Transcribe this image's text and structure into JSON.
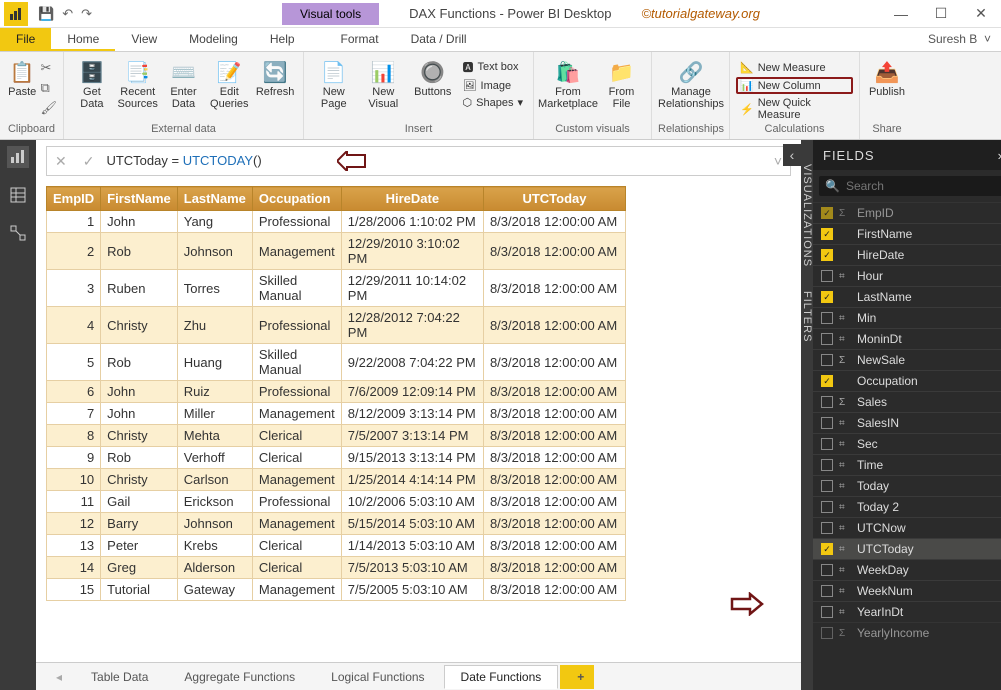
{
  "titlebar": {
    "app_title": "DAX Functions - Power BI Desktop",
    "visual_tools": "Visual tools",
    "watermark": "©tutorialgateway.org"
  },
  "menu": {
    "file": "File",
    "tabs": [
      "Home",
      "View",
      "Modeling",
      "Help",
      "Format",
      "Data / Drill"
    ],
    "user": "Suresh B"
  },
  "ribbon": {
    "clipboard": {
      "paste": "Paste",
      "label": "Clipboard"
    },
    "external": {
      "get": "Get\nData",
      "recent": "Recent\nSources",
      "enter": "Enter\nData",
      "edit": "Edit\nQueries",
      "refresh": "Refresh",
      "label": "External data"
    },
    "insert": {
      "newpage": "New\nPage",
      "newvisual": "New\nVisual",
      "buttons": "Buttons",
      "text": "Text box",
      "image": "Image",
      "shapes": "Shapes",
      "label": "Insert"
    },
    "custom": {
      "market": "From\nMarketplace",
      "file": "From\nFile",
      "label": "Custom visuals"
    },
    "rel": {
      "manage": "Manage\nRelationships",
      "label": "Relationships"
    },
    "calc": {
      "measure": "New Measure",
      "column": "New Column",
      "quick": "New Quick Measure",
      "label": "Calculations"
    },
    "share": {
      "publish": "Publish",
      "label": "Share"
    }
  },
  "formula": {
    "text": "UTCToday = ",
    "func": "UTCTODAY",
    "tail": "()"
  },
  "table": {
    "headers": [
      "EmpID",
      "FirstName",
      "LastName",
      "Occupation",
      "HireDate",
      "UTCToday"
    ],
    "rows": [
      [
        1,
        "John",
        "Yang",
        "Professional",
        "1/28/2006 1:10:02 PM",
        "8/3/2018 12:00:00 AM"
      ],
      [
        2,
        "Rob",
        "Johnson",
        "Management",
        "12/29/2010 3:10:02 PM",
        "8/3/2018 12:00:00 AM"
      ],
      [
        3,
        "Ruben",
        "Torres",
        "Skilled Manual",
        "12/29/2011 10:14:02 PM",
        "8/3/2018 12:00:00 AM"
      ],
      [
        4,
        "Christy",
        "Zhu",
        "Professional",
        "12/28/2012 7:04:22 PM",
        "8/3/2018 12:00:00 AM"
      ],
      [
        5,
        "Rob",
        "Huang",
        "Skilled Manual",
        "9/22/2008 7:04:22 PM",
        "8/3/2018 12:00:00 AM"
      ],
      [
        6,
        "John",
        "Ruiz",
        "Professional",
        "7/6/2009 12:09:14 PM",
        "8/3/2018 12:00:00 AM"
      ],
      [
        7,
        "John",
        "Miller",
        "Management",
        "8/12/2009 3:13:14 PM",
        "8/3/2018 12:00:00 AM"
      ],
      [
        8,
        "Christy",
        "Mehta",
        "Clerical",
        "7/5/2007 3:13:14 PM",
        "8/3/2018 12:00:00 AM"
      ],
      [
        9,
        "Rob",
        "Verhoff",
        "Clerical",
        "9/15/2013 3:13:14 PM",
        "8/3/2018 12:00:00 AM"
      ],
      [
        10,
        "Christy",
        "Carlson",
        "Management",
        "1/25/2014 4:14:14 PM",
        "8/3/2018 12:00:00 AM"
      ],
      [
        11,
        "Gail",
        "Erickson",
        "Professional",
        "10/2/2006 5:03:10 AM",
        "8/3/2018 12:00:00 AM"
      ],
      [
        12,
        "Barry",
        "Johnson",
        "Management",
        "5/15/2014 5:03:10 AM",
        "8/3/2018 12:00:00 AM"
      ],
      [
        13,
        "Peter",
        "Krebs",
        "Clerical",
        "1/14/2013 5:03:10 AM",
        "8/3/2018 12:00:00 AM"
      ],
      [
        14,
        "Greg",
        "Alderson",
        "Clerical",
        "7/5/2013 5:03:10 AM",
        "8/3/2018 12:00:00 AM"
      ],
      [
        15,
        "Tutorial",
        "Gateway",
        "Management",
        "7/5/2005 5:03:10 AM",
        "8/3/2018 12:00:00 AM"
      ]
    ]
  },
  "sheets": {
    "tabs": [
      "Table Data",
      "Aggregate Functions",
      "Logical Functions",
      "Date Functions"
    ],
    "active": 3,
    "add": "+"
  },
  "panes": {
    "viz": "VISUALIZATIONS",
    "filters": "FILTERS",
    "fields_head": "FIELDS",
    "search_ph": "Search"
  },
  "fields": [
    {
      "name": "EmpID",
      "checked": true,
      "ico": "Σ",
      "dim": true
    },
    {
      "name": "FirstName",
      "checked": true,
      "ico": ""
    },
    {
      "name": "HireDate",
      "checked": true,
      "ico": ""
    },
    {
      "name": "Hour",
      "checked": false,
      "ico": "⌗"
    },
    {
      "name": "LastName",
      "checked": true,
      "ico": ""
    },
    {
      "name": "Min",
      "checked": false,
      "ico": "⌗"
    },
    {
      "name": "MoninDt",
      "checked": false,
      "ico": "⌗"
    },
    {
      "name": "NewSale",
      "checked": false,
      "ico": "Σ"
    },
    {
      "name": "Occupation",
      "checked": true,
      "ico": ""
    },
    {
      "name": "Sales",
      "checked": false,
      "ico": "Σ"
    },
    {
      "name": "SalesIN",
      "checked": false,
      "ico": "⌗"
    },
    {
      "name": "Sec",
      "checked": false,
      "ico": "⌗"
    },
    {
      "name": "Time",
      "checked": false,
      "ico": "⌗"
    },
    {
      "name": "Today",
      "checked": false,
      "ico": "⌗"
    },
    {
      "name": "Today 2",
      "checked": false,
      "ico": "⌗"
    },
    {
      "name": "UTCNow",
      "checked": false,
      "ico": "⌗"
    },
    {
      "name": "UTCToday",
      "checked": true,
      "ico": "⌗",
      "sel": true
    },
    {
      "name": "WeekDay",
      "checked": false,
      "ico": "⌗"
    },
    {
      "name": "WeekNum",
      "checked": false,
      "ico": "⌗"
    },
    {
      "name": "YearInDt",
      "checked": false,
      "ico": "⌗"
    },
    {
      "name": "YearlyIncome",
      "checked": false,
      "ico": "Σ",
      "dim": true
    }
  ]
}
